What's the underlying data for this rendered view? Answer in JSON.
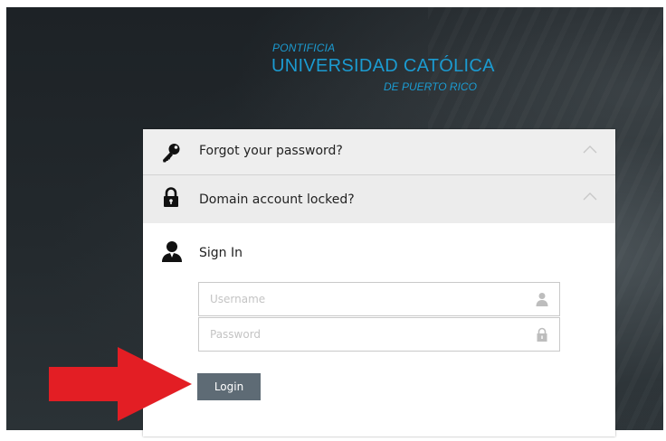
{
  "logo": {
    "line1": "PONTIFICIA",
    "line2": "UNIVERSIDAD CATÓLICA",
    "line3": "DE PUERTO RICO",
    "color": "#1b9bd1"
  },
  "accordion": [
    {
      "label": "Forgot your password?",
      "icon": "key-icon"
    },
    {
      "label": "Domain account locked?",
      "icon": "lock-icon"
    }
  ],
  "signin": {
    "title": "Sign In",
    "icon": "user-icon",
    "username_placeholder": "Username",
    "password_placeholder": "Password",
    "login_label": "Login"
  },
  "colors": {
    "background": "#23292d",
    "button": "#5e6b75",
    "annotation_arrow": "#e31e24"
  }
}
